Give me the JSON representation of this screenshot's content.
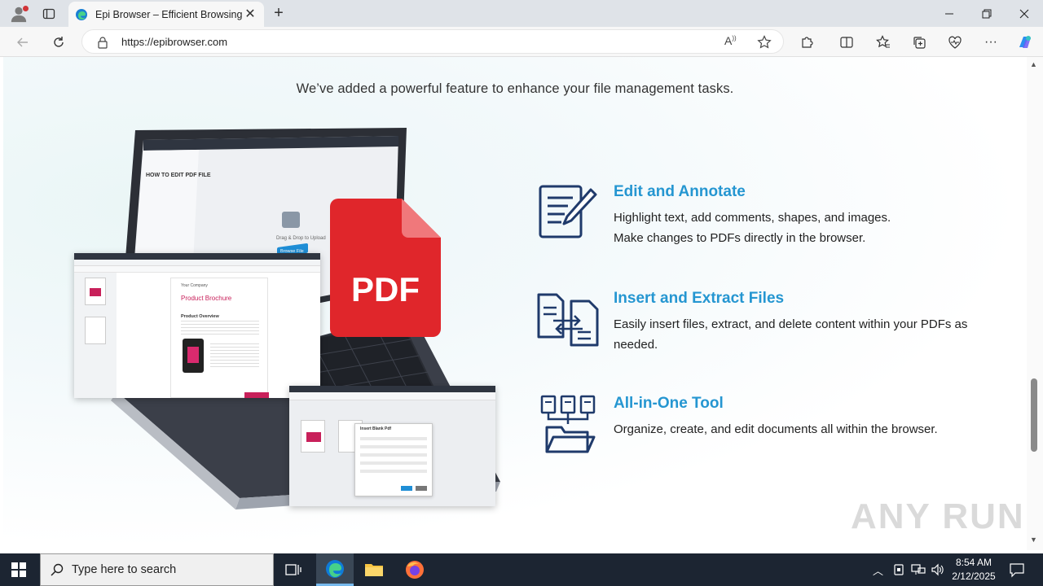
{
  "browser": {
    "tab_title": "Epi Browser – Efficient Browsing, Seamless PDF Editing",
    "url": "https://epibrowser.com"
  },
  "page": {
    "intro": "We’ve added a powerful feature to enhance your file management tasks.",
    "pdf_badge": "PDF",
    "features": [
      {
        "title": "Edit and Annotate",
        "line1": "Highlight text, add comments, shapes, and images.",
        "line2": "Make changes to PDFs directly in the browser.",
        "icon": "edit-document-icon"
      },
      {
        "title": "Insert and Extract Files",
        "line1": "Easily insert files, extract, and delete content within your PDFs as needed.",
        "icon": "file-transfer-icon"
      },
      {
        "title": "All-in-One Tool",
        "line1": "Organize, create, and edit documents all within the browser.",
        "icon": "folder-documents-icon"
      }
    ],
    "mock": {
      "howto_title": "HOW TO EDIT PDF FILE",
      "brochure_company": "Your Company",
      "brochure_title": "Product Brochure",
      "brochure_section": "Product Overview",
      "drag_text": "Drag & Drop to Upload",
      "browse_button": "Browse File",
      "dialog_title": "Insert Blank Pdf"
    }
  },
  "taskbar": {
    "search_placeholder": "Type here to search",
    "time": "8:54 AM",
    "date": "2/12/2025"
  },
  "watermark": "ANY RUN",
  "colors": {
    "accent": "#2596d1",
    "pdf_red": "#e0262b",
    "icon_navy": "#1f3a6b"
  }
}
